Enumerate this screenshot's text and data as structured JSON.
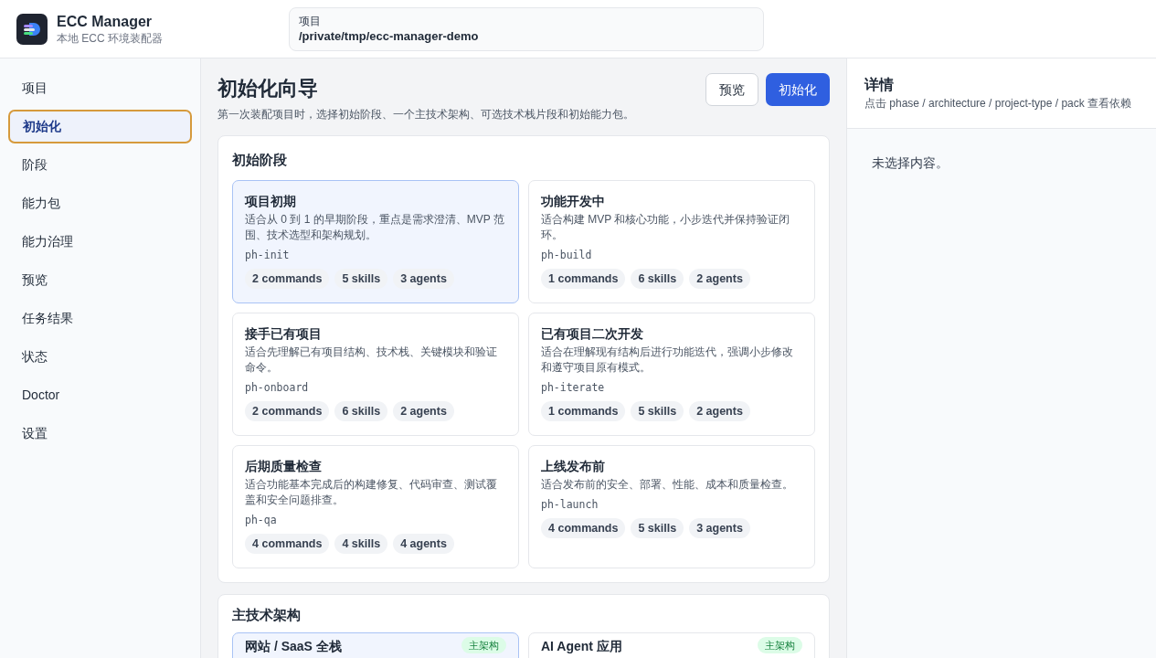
{
  "app": {
    "title": "ECC Manager",
    "subtitle": "本地 ECC 环境装配器"
  },
  "project": {
    "label": "项目",
    "path": "/private/tmp/ecc-manager-demo"
  },
  "sidebar": {
    "items": [
      {
        "label": "项目",
        "selected": false
      },
      {
        "label": "初始化",
        "selected": true
      },
      {
        "label": "阶段",
        "selected": false
      },
      {
        "label": "能力包",
        "selected": false
      },
      {
        "label": "能力治理",
        "selected": false
      },
      {
        "label": "预览",
        "selected": false
      },
      {
        "label": "任务结果",
        "selected": false
      },
      {
        "label": "状态",
        "selected": false
      },
      {
        "label": "Doctor",
        "selected": false
      },
      {
        "label": "设置",
        "selected": false
      }
    ]
  },
  "main": {
    "title": "初始化向导",
    "description": "第一次装配项目时，选择初始阶段、一个主技术架构、可选技术栈片段和初始能力包。",
    "buttons": [
      {
        "label": "预览",
        "kind": "secondary"
      },
      {
        "label": "初始化",
        "kind": "primary"
      }
    ]
  },
  "phases": {
    "title": "初始阶段",
    "items": [
      {
        "name": "项目初期",
        "description": "适合从 0 到 1 的早期阶段，重点是需求澄清、MVP 范围、技术选型和架构规划。",
        "id": "ph-init",
        "tags": [
          "2 commands",
          "5 skills",
          "3 agents"
        ],
        "selected": true
      },
      {
        "name": "功能开发中",
        "description": "适合构建 MVP 和核心功能，小步迭代并保持验证闭环。",
        "id": "ph-build",
        "tags": [
          "1 commands",
          "6 skills",
          "2 agents"
        ],
        "selected": false
      },
      {
        "name": "接手已有项目",
        "description": "适合先理解已有项目结构、技术栈、关键模块和验证命令。",
        "id": "ph-onboard",
        "tags": [
          "2 commands",
          "6 skills",
          "2 agents"
        ],
        "selected": false
      },
      {
        "name": "已有项目二次开发",
        "description": "适合在理解现有结构后进行功能迭代，强调小步修改和遵守项目原有模式。",
        "id": "ph-iterate",
        "tags": [
          "1 commands",
          "5 skills",
          "2 agents"
        ],
        "selected": false
      },
      {
        "name": "后期质量检查",
        "description": "适合功能基本完成后的构建修复、代码审查、测试覆盖和安全问题排查。",
        "id": "ph-qa",
        "tags": [
          "4 commands",
          "4 skills",
          "4 agents"
        ],
        "selected": false
      },
      {
        "name": "上线发布前",
        "description": "适合发布前的安全、部署、性能、成本和质量检查。",
        "id": "ph-launch",
        "tags": [
          "4 commands",
          "5 skills",
          "3 agents"
        ],
        "selected": false
      }
    ]
  },
  "architectures": {
    "title": "主技术架构",
    "items": [
      {
        "name": "网站 / SaaS 全栈",
        "badge": "主架构",
        "selected": true
      },
      {
        "name": "AI Agent 应用",
        "badge": "主架构",
        "selected": false
      }
    ]
  },
  "details": {
    "title": "详情",
    "hint": "点击 phase / architecture / project-type / pack 查看依赖",
    "empty": "未选择内容。"
  }
}
